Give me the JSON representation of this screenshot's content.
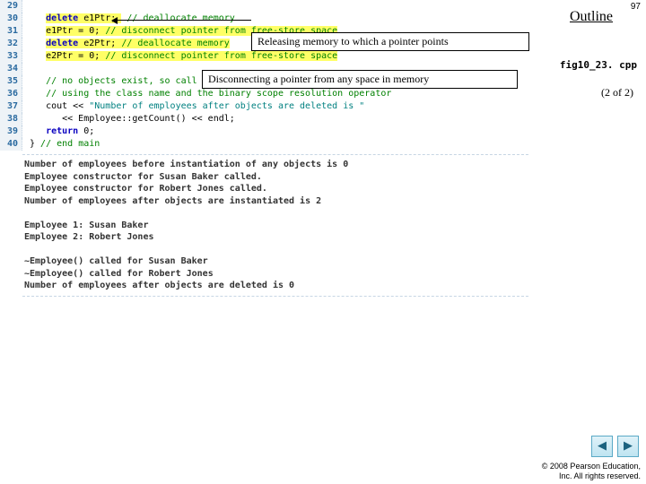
{
  "header": {
    "outline": "Outline",
    "slide_number": "97",
    "filename": "fig10_23. cpp",
    "pager": "(2 of 2)"
  },
  "callouts": {
    "release": "Releasing memory to which a pointer points",
    "disconnect": "Disconnecting a pointer from any space in memory"
  },
  "code": {
    "l29_txt": "",
    "l30_kw": "delete",
    "l30_rest": " e1Ptr; ",
    "l30_cmt": "// deallocate memory",
    "l31_a": "e1Ptr = ",
    "l31_z": "0",
    "l31_b": "; ",
    "l31_cmt": "// disconnect pointer from free-store space",
    "l32_kw": "delete",
    "l32_rest": " e2Ptr; ",
    "l32_cmt": "// deallocate memory",
    "l33_a": "e2Ptr = ",
    "l33_z": "0",
    "l33_b": "; ",
    "l33_cmt": "// disconnect pointer from free-store space",
    "l34_txt": "",
    "l35_cmt": "// no objects exist, so call static member function getCount again",
    "l36_cmt": "// using the class name and the binary scope resolution operator",
    "l37_a": "cout << ",
    "l37_str": "\"Number of employees after objects are deleted is \"",
    "l38_a": "   << Employee::getCount() << endl;",
    "l39_kw": "return",
    "l39_rest": " 0;",
    "l40_a": "} ",
    "l40_cmt": "// end main"
  },
  "output": "Number of employees before instantiation of any objects is 0\nEmployee constructor for Susan Baker called.\nEmployee constructor for Robert Jones called.\nNumber of employees after objects are instantiated is 2\n\nEmployee 1: Susan Baker\nEmployee 2: Robert Jones\n\n~Employee() called for Susan Baker\n~Employee() called for Robert Jones\nNumber of employees after objects are deleted is 0",
  "nav": {
    "prev": "◀",
    "next": "▶"
  },
  "footer": {
    "line1": "© 2008 Pearson Education,",
    "line2": "Inc.  All rights reserved."
  }
}
